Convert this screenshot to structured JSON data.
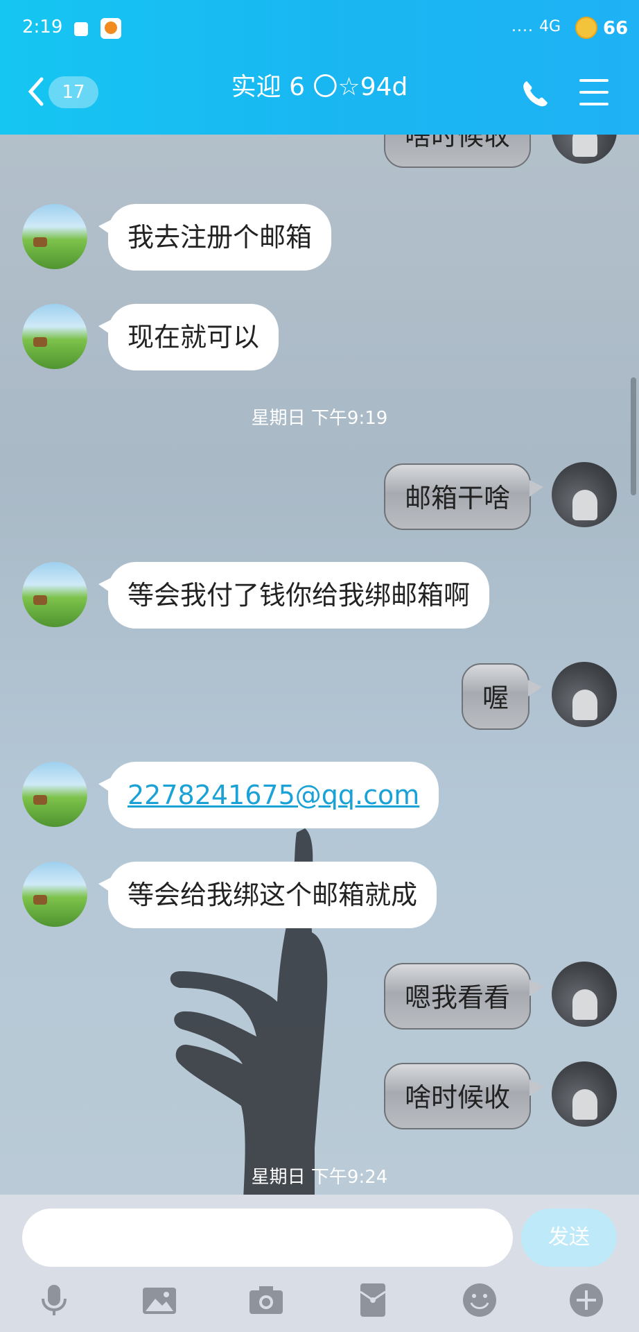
{
  "status_bar": {
    "time": "2:19",
    "signal": "....",
    "network": "4G",
    "battery": "66"
  },
  "header": {
    "unread_count": "17",
    "title": "实迎 6 〇☆94d"
  },
  "messages": [
    {
      "side": "right",
      "text": "啥时候收"
    },
    {
      "side": "left",
      "text": "我去注册个邮箱"
    },
    {
      "side": "left",
      "text": "现在就可以"
    },
    {
      "side": "timestamp",
      "text": "星期日 下午9:19"
    },
    {
      "side": "right",
      "text": "邮箱干啥"
    },
    {
      "side": "left",
      "text": "等会我付了钱你给我绑邮箱啊"
    },
    {
      "side": "right",
      "text": "喔"
    },
    {
      "side": "left",
      "text": "2278241675@qq.com",
      "link": true
    },
    {
      "side": "left",
      "text": "等会给我绑这个邮箱就成"
    },
    {
      "side": "right",
      "text": "嗯我看看"
    },
    {
      "side": "right",
      "text": "啥时候收"
    },
    {
      "side": "timestamp",
      "text": "星期日 下午9:24"
    }
  ],
  "input": {
    "placeholder": "",
    "send_label": "发送"
  },
  "toolbar": {
    "icons": [
      "microphone-icon",
      "image-icon",
      "camera-icon",
      "red-packet-icon",
      "emoji-icon",
      "plus-icon"
    ]
  },
  "colors": {
    "header_start": "#16c6f2",
    "header_end": "#1fb2f4",
    "link": "#1aa1d6",
    "send_button": "#bde9f9"
  }
}
